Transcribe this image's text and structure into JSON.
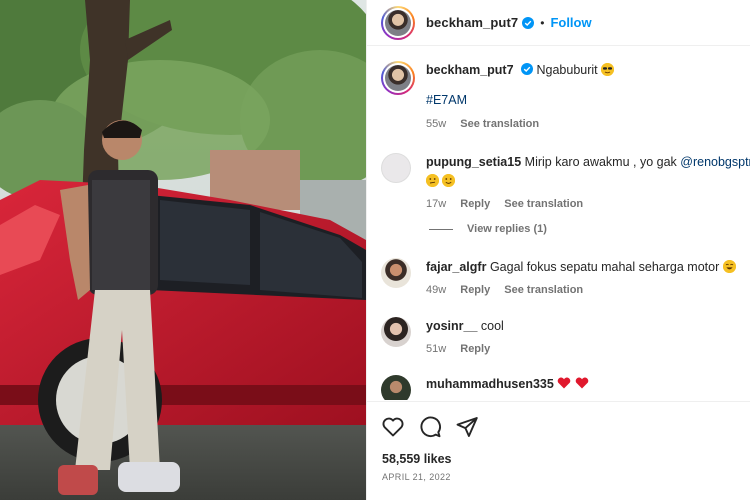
{
  "post": {
    "username": "beckham_put7",
    "follow_label": "Follow",
    "separator": "•",
    "caption": "Ngabuburit",
    "hashtag": "#E7AM",
    "caption_age": "55w",
    "see_translation": "See translation"
  },
  "comments": [
    {
      "username": "pupung_setia15",
      "text": "Mirip karo awakmu , yo gak ",
      "mention": "@renobgsptra",
      "age": "17w",
      "reply": "Reply",
      "see_translation": "See translation",
      "view_replies": "View replies (1)"
    },
    {
      "username": "fajar_algfr",
      "text": "Gagal fokus sepatu mahal seharga motor",
      "age": "49w",
      "reply": "Reply",
      "see_translation": "See translation"
    },
    {
      "username": "yosinr__",
      "text": "cool",
      "age": "51w",
      "reply": "Reply"
    },
    {
      "username": "muhammadhusen335",
      "text": ""
    }
  ],
  "footer": {
    "likes": "58,559 likes",
    "date": "APRIL 21, 2022"
  },
  "icons": {
    "like": "heart-outline-icon",
    "comment": "comment-bubble-icon",
    "share": "paper-plane-icon",
    "verified": "verified-badge-icon"
  },
  "colors": {
    "accent": "#0095f6",
    "verified": "#0095f6",
    "secondary_text": "#737373",
    "mention": "#00376b"
  }
}
